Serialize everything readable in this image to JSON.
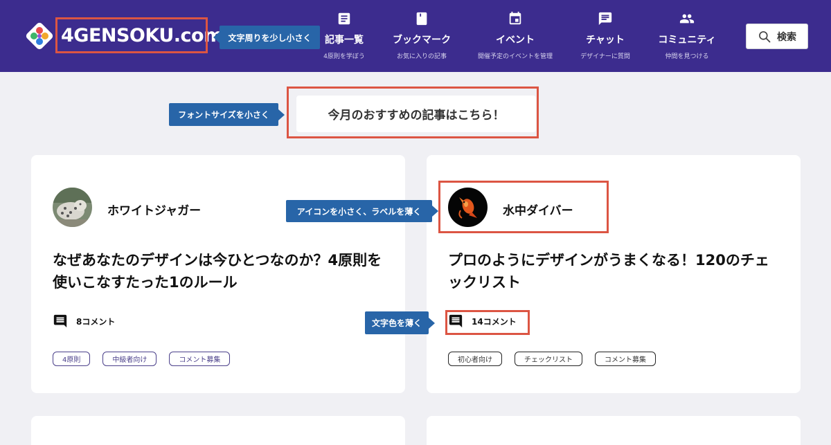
{
  "header": {
    "logo_text": "4GENSOKU.com",
    "logo_icon": "diamond-dots-logo",
    "background_color": "#3c2c8e",
    "nav": [
      {
        "label": "記事一覧",
        "sub": "4原則を学ぼう",
        "icon": "article-icon"
      },
      {
        "label": "ブックマーク",
        "sub": "お気に入りの記事",
        "icon": "bookmark-icon"
      },
      {
        "label": "イベント",
        "sub": "開催予定のイベントを管理",
        "icon": "calendar-icon"
      },
      {
        "label": "チャット",
        "sub": "デザイナーに質問",
        "icon": "chat-icon"
      },
      {
        "label": "コミュニティ",
        "sub": "仲間を見つける",
        "icon": "people-icon"
      }
    ],
    "search_label": "検索"
  },
  "featured_banner": "今月のおすすめの記事はこちら！",
  "cards": [
    {
      "author": "ホワイトジャガー",
      "title": "なぜあなたのデザインは今ひとつなのか？4原則を使いこなすたった1のルール",
      "comments": "8コメント",
      "tags": [
        "4原則",
        "中級者向け",
        "コメント募集"
      ]
    },
    {
      "author": "水中ダイバー",
      "title": "プロのようにデザインがうまくなる！120のチェックリスト",
      "comments": "14コメント",
      "tags": [
        "初心者向け",
        "チェックリスト",
        "コメント募集"
      ]
    }
  ],
  "annotations": {
    "logo_note": "文字周りを少し小さく",
    "banner_note": "フォントサイズを小さく",
    "author_note": "アイコンを小さく、ラベルを薄く",
    "comment_note": "文字色を薄く",
    "box_color": "#dc5543",
    "callout_color": "#2865a8"
  }
}
